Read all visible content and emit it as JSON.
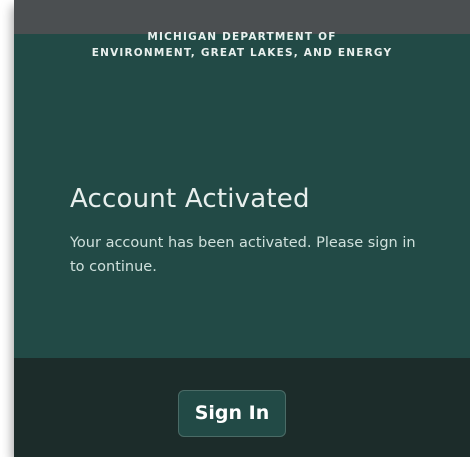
{
  "header": {
    "agency_line1": "MICHIGAN DEPARTMENT OF",
    "agency_line2": "ENVIRONMENT, GREAT LAKES, AND ENERGY"
  },
  "main": {
    "title": "Account Activated",
    "message": "Your account has been activated. Please sign in to continue."
  },
  "footer": {
    "sign_in_label": "Sign In"
  },
  "colors": {
    "panel": "#224a46",
    "footer": "#1c2c2a",
    "topbar": "#4b4f51",
    "text": "#e8efed"
  }
}
